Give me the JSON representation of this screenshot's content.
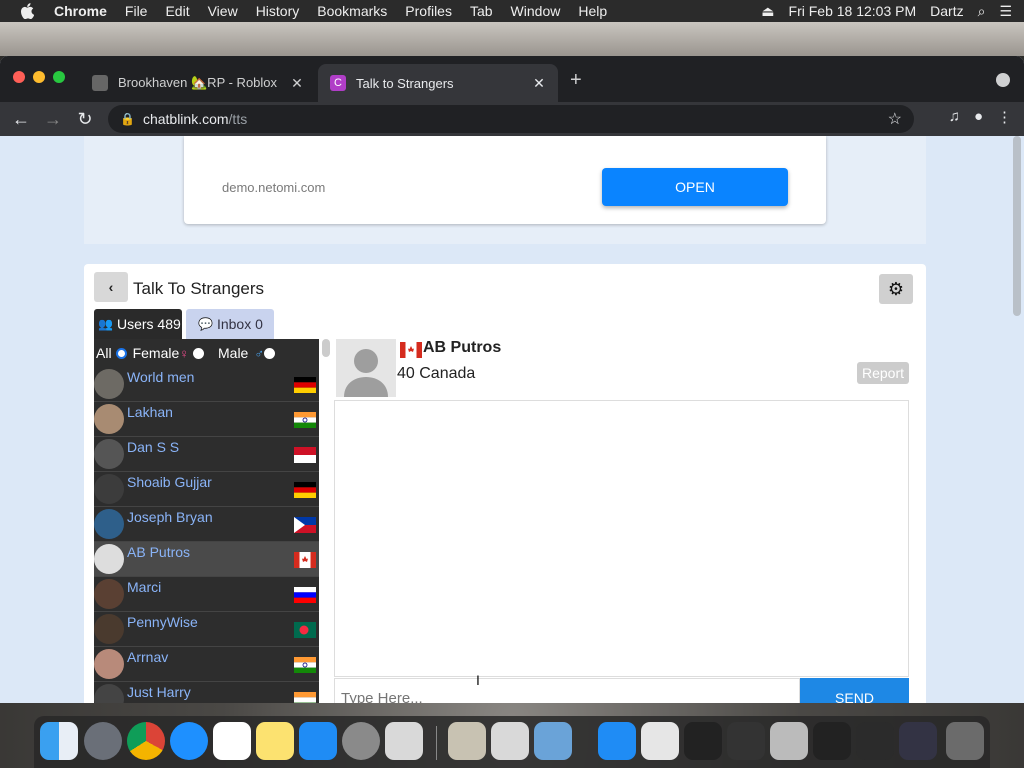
{
  "menubar": {
    "app": "Chrome",
    "items": [
      "File",
      "Edit",
      "View",
      "History",
      "Bookmarks",
      "Profiles",
      "Tab",
      "Window",
      "Help"
    ],
    "datetime": "Fri Feb 18  12:03 PM",
    "user": "Dartz"
  },
  "tabs": [
    {
      "title": "Brookhaven 🏡RP - Roblox",
      "active": false
    },
    {
      "title": "Talk to Strangers",
      "active": true
    }
  ],
  "omnibox": {
    "host": "chatblink.com",
    "path": "/tts"
  },
  "ad": {
    "domain": "demo.netomi.com",
    "button": "OPEN"
  },
  "panel": {
    "title": "Talk To Strangers",
    "users_tab": "Users 489",
    "inbox_tab": "Inbox 0",
    "filters": {
      "all": "All",
      "female": "Female",
      "male": "Male"
    }
  },
  "users": [
    {
      "name": "World men",
      "flag": "de"
    },
    {
      "name": "Lakhan",
      "flag": "in"
    },
    {
      "name": "Dan S S",
      "flag": "id"
    },
    {
      "name": "Shoaib Gujjar",
      "flag": "de"
    },
    {
      "name": "Joseph Bryan",
      "flag": "ph"
    },
    {
      "name": "AB Putros",
      "flag": "ca"
    },
    {
      "name": "Marci",
      "flag": "si"
    },
    {
      "name": "PennyWise",
      "flag": "bd"
    },
    {
      "name": "Arrnav",
      "flag": "in"
    },
    {
      "name": "Just Harry",
      "flag": "in"
    }
  ],
  "selected_user": "AB Putros",
  "chat": {
    "name": "AB Putros",
    "info": "40 Canada",
    "report": "Report",
    "placeholder": "Type Here...",
    "send": "SEND"
  },
  "colors": {
    "accent": "#1e88e5",
    "open_button": "#0a84ff",
    "link_blue": "#8ab4f8"
  }
}
